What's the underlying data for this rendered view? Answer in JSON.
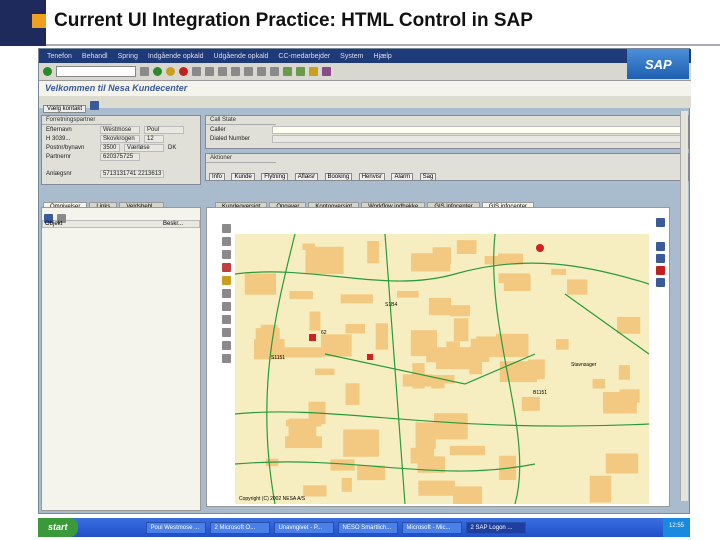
{
  "slide": {
    "title": "Current UI Integration Practice: HTML Control in SAP"
  },
  "sap": {
    "menu": [
      "Tenefon",
      "Behandl",
      "Spring",
      "Indgående opkald",
      "Udgående opkald",
      "CC-medarbejder",
      "System",
      "Hjælp"
    ],
    "logo": "SAP",
    "welcome": "Velkommen til Nesa Kundecenter",
    "button": "Vælg kontakt",
    "partner": {
      "title": "Forretningspartner",
      "rows": [
        {
          "label": "Efternavn",
          "v1": "Westmose",
          "v2": "Poul"
        },
        {
          "label": "H 3039...",
          "v1": "Skovkrogen",
          "v2": "12"
        },
        {
          "label": "Postnr/bynavn",
          "v1": "3500",
          "v2": "Værløse",
          "v3": "DK"
        },
        {
          "label": "Partnernr",
          "v1": "620375725"
        }
      ],
      "attachment_label": "Anlægsnr",
      "attachment_value": "5713131741 2213613"
    },
    "call_state": {
      "title": "Call State",
      "caller": "Caller",
      "dialed": "Dialed Number"
    },
    "actions": {
      "title": "Aktioner",
      "items": [
        "Info",
        "Kunde",
        "Flytning",
        "Aflæsr",
        "Booking",
        "Henvisr",
        "Alarm",
        "Sag"
      ]
    },
    "left_tabs": [
      "Omgivelser",
      "Links",
      "Veldsbehl..."
    ],
    "left_cols": [
      "Objekt",
      "Beskr..."
    ],
    "right_tabs": [
      "Kundeoversigt",
      "Opgaver",
      "Kontooversigt",
      "Workflow indbakke",
      "GIS infocenter",
      "GIS infocenter"
    ],
    "map": {
      "copyright": "Copyright (C) 2002 NESA A/S",
      "labels": [
        "B1151",
        "62",
        "S1B4",
        "Stavnsager",
        "S1151"
      ],
      "colors": {
        "bg": "#f6eec0",
        "building": "#f3c880",
        "road": "#2a9a3a"
      }
    }
  },
  "taskbar": {
    "start": "start",
    "tasks": [
      "Poul Westmose ...",
      "2 Microsoft O...",
      "Unavngivet - P...",
      "NESO Smartlich...",
      "Microsoft - Mic...",
      "2 SAP Logon ..."
    ],
    "clock": "12:55"
  }
}
